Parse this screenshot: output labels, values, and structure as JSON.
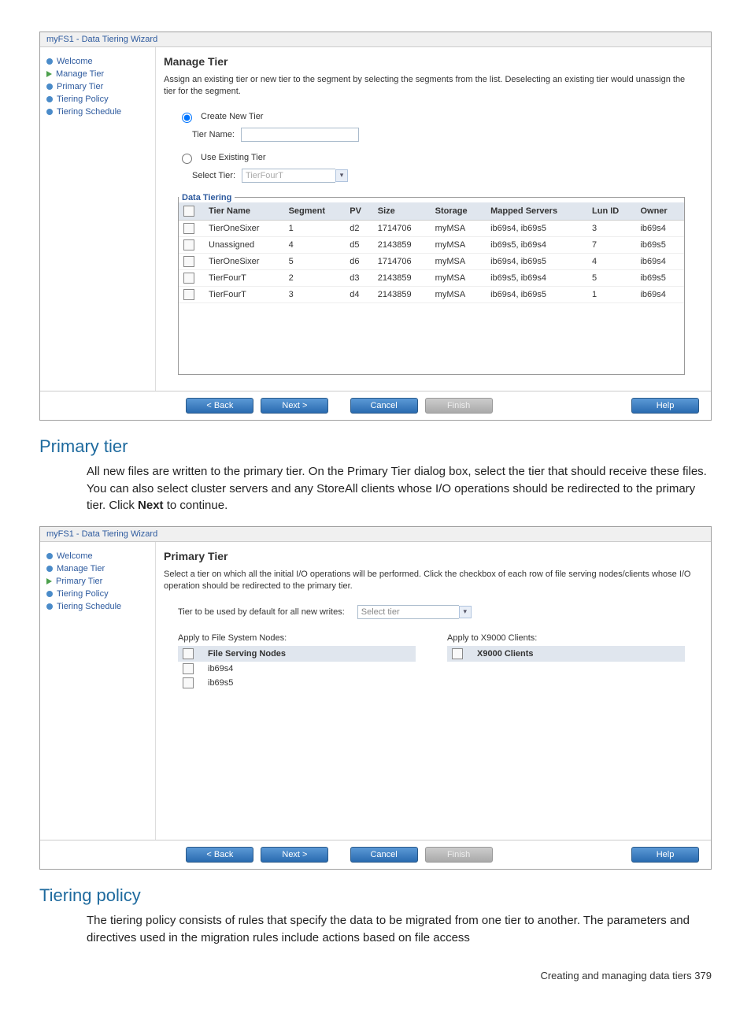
{
  "wizard1": {
    "title": "myFS1 - Data Tiering Wizard",
    "nav": [
      "Welcome",
      "Manage Tier",
      "Primary Tier",
      "Tiering Policy",
      "Tiering Schedule"
    ],
    "active_idx": 1,
    "heading": "Manage Tier",
    "desc": "Assign an existing tier or new tier to the segment by selecting the segments from the list. Deselecting an existing tier would unassign the tier for the segment.",
    "radio1": "Create New Tier",
    "tier_name_label": "Tier Name:",
    "radio2": "Use Existing Tier",
    "select_tier_label": "Select Tier:",
    "select_tier_value": "TierFourT",
    "fieldset": "Data Tiering",
    "cols": [
      "Tier Name",
      "Segment",
      "PV",
      "Size",
      "Storage",
      "Mapped Servers",
      "Lun ID",
      "Owner"
    ],
    "rows": [
      [
        "TierOneSixer",
        "1",
        "d2",
        "1714706",
        "myMSA",
        "ib69s4, ib69s5",
        "3",
        "ib69s4"
      ],
      [
        "Unassigned",
        "4",
        "d5",
        "2143859",
        "myMSA",
        "ib69s5, ib69s4",
        "7",
        "ib69s5"
      ],
      [
        "TierOneSixer",
        "5",
        "d6",
        "1714706",
        "myMSA",
        "ib69s4, ib69s5",
        "4",
        "ib69s4"
      ],
      [
        "TierFourT",
        "2",
        "d3",
        "2143859",
        "myMSA",
        "ib69s5, ib69s4",
        "5",
        "ib69s5"
      ],
      [
        "TierFourT",
        "3",
        "d4",
        "2143859",
        "myMSA",
        "ib69s4, ib69s5",
        "1",
        "ib69s4"
      ]
    ]
  },
  "section1_heading": "Primary tier",
  "section1_body": "All new files are written to the primary tier. On the Primary Tier dialog box, select the tier that should receive these files. You can also select cluster servers and any StoreAll clients whose I/O operations should be redirected to the primary tier. Click ",
  "section1_bold": "Next",
  "section1_tail": " to continue.",
  "wizard2": {
    "title": "myFS1 - Data Tiering Wizard",
    "nav": [
      "Welcome",
      "Manage Tier",
      "Primary Tier",
      "Tiering Policy",
      "Tiering Schedule"
    ],
    "active_idx": 2,
    "heading": "Primary Tier",
    "desc": "Select a tier on which all the initial I/O operations will be performed. Click the checkbox of each row of file serving nodes/clients whose I/O operation should be redirected to the primary tier.",
    "default_label": "Tier to be used by default for all new writes:",
    "default_value": "Select tier",
    "left_label": "Apply to File System Nodes:",
    "left_header": "File Serving Nodes",
    "left_rows": [
      "ib69s4",
      "ib69s5"
    ],
    "right_label": "Apply to X9000 Clients:",
    "right_header": "X9000 Clients"
  },
  "section2_heading": "Tiering policy",
  "section2_body": "The tiering policy consists of rules that specify the data to be migrated from one tier to another. The parameters and directives used in the migration rules include actions based on file access",
  "buttons": {
    "back": "< Back",
    "next": "Next >",
    "cancel": "Cancel",
    "finish": "Finish",
    "help": "Help"
  },
  "footer": "Creating and managing data tiers   379"
}
